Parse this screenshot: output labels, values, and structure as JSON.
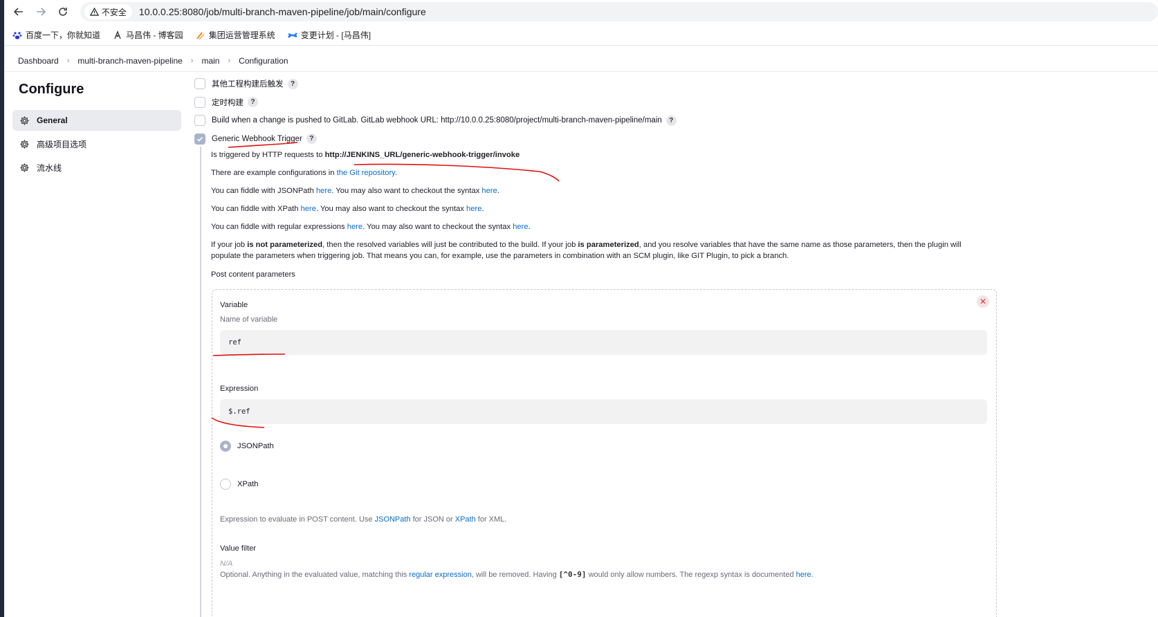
{
  "browser": {
    "security_label": "不安全",
    "url": "10.0.0.25:8080/job/multi-branch-maven-pipeline/job/main/configure",
    "bookmarks": [
      {
        "label": "百度一下，你就知道",
        "icon": "baidu-paw-icon"
      },
      {
        "label": "马昌伟 - 博客园",
        "icon": "cnblogs-icon"
      },
      {
        "label": "集团运营管理系统",
        "icon": "ops-system-icon"
      },
      {
        "label": "变更计划 - [马昌伟]",
        "icon": "confluence-icon"
      }
    ]
  },
  "breadcrumb": [
    "Dashboard",
    "multi-branch-maven-pipeline",
    "main",
    "Configuration"
  ],
  "sidebar": {
    "title": "Configure",
    "items": [
      {
        "label": "General",
        "active": true,
        "icon": "gear-icon"
      },
      {
        "label": "高级项目选项",
        "active": false,
        "icon": "gear-icon"
      },
      {
        "label": "流水线",
        "active": false,
        "icon": "gear-icon"
      }
    ]
  },
  "triggers": [
    {
      "label": "其他工程构建后触发",
      "checked": false
    },
    {
      "label": "定时构建",
      "checked": false
    },
    {
      "label": "Build when a change is pushed to GitLab. GitLab webhook URL: http://10.0.0.25:8080/project/multi-branch-maven-pipeline/main",
      "checked": false
    },
    {
      "label": "Generic Webhook Trigger",
      "checked": true
    }
  ],
  "webhook": {
    "triggered_prefix": "Is triggered by HTTP requests to ",
    "triggered_url": "http://JENKINS_URL/generic-webhook-trigger/invoke",
    "example_prefix": "There are example configurations in ",
    "example_link": "the Git repository",
    "example_suffix": ".",
    "jsonpath_line": {
      "a": "You can fiddle with JSONPath ",
      "l1": "here",
      "b": ". You may also want to checkout the syntax ",
      "l2": "here",
      "c": "."
    },
    "xpath_line": {
      "a": "You can fiddle with XPath ",
      "l1": "here",
      "b": ". You may also want to checkout the syntax ",
      "l2": "here",
      "c": "."
    },
    "regex_line": {
      "a": "You can fiddle with regular expressions ",
      "l1": "here",
      "b": ". You may also want to checkout the syntax ",
      "l2": "here",
      "c": "."
    },
    "param_p1": "If your job ",
    "param_b1": "is not parameterized",
    "param_p2": ", then the resolved variables will just be contributed to the build. If your job ",
    "param_b2": "is parameterized",
    "param_p3": ", and you resolve variables that have the same name as those parameters, then the plugin will",
    "param_line2": "populate the parameters when triggering job. That means you can, for example, use the parameters in combination with an SCM plugin, like GIT Plugin, to pick a branch.",
    "post_content_label": "Post content parameters"
  },
  "post_param": {
    "variable_label": "Variable",
    "variable_desc": "Name of variable",
    "variable_value": "ref",
    "expression_label": "Expression",
    "expression_value": "$.ref",
    "radio_jsonpath": "JSONPath",
    "radio_xpath": "XPath",
    "selected": "JSONPath",
    "expr_help": {
      "a": "Expression to evaluate in POST content. Use ",
      "l1": "JSONPath",
      "b": " for JSON or ",
      "l2": "XPath",
      "c": " for XML."
    },
    "value_filter_label": "Value filter",
    "value_filter_placeholder": "N/A",
    "optional_help": {
      "a": "Optional. Anything in the evaluated value, matching this ",
      "l1": "regular expression",
      "b": ", will be removed. Having ",
      "code": "[^0-9]",
      "c": " would only allow numbers. The regexp syntax is documented ",
      "l2": "here",
      "d": "."
    }
  },
  "colors": {
    "link": "#0b6bcb",
    "annotation_red": "#e01010",
    "active_nav": "#eaebef"
  }
}
